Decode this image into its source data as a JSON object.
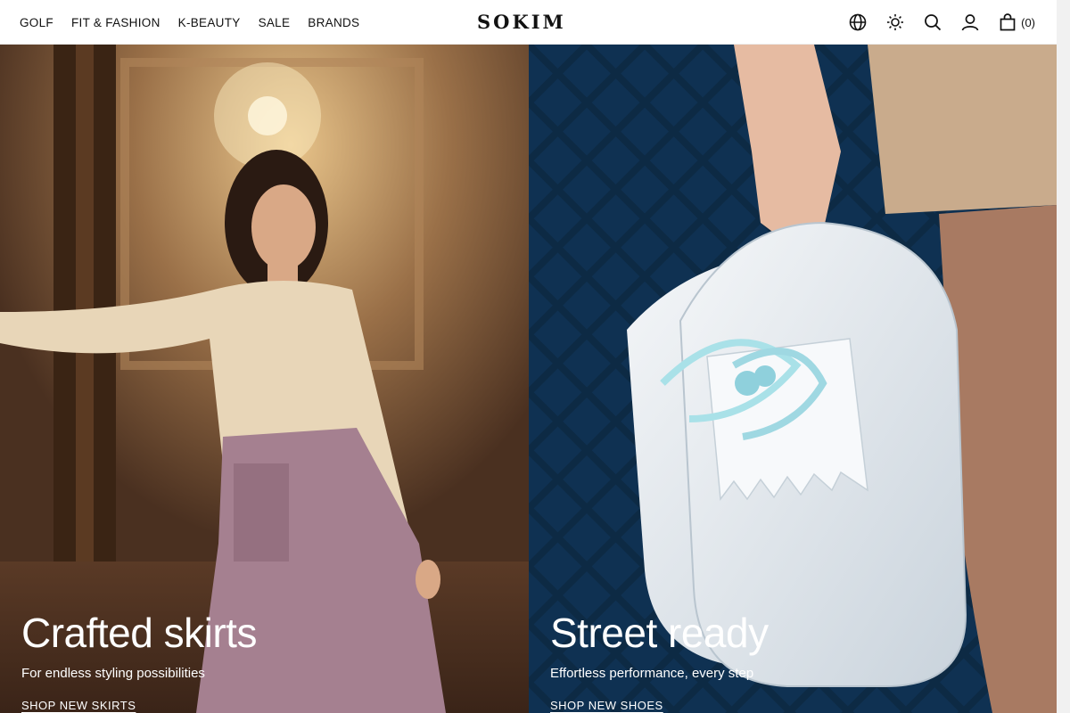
{
  "nav": {
    "links": [
      "GOLF",
      "FIT & FASHION",
      "K-BEAUTY",
      "SALE",
      "BRANDS"
    ]
  },
  "brand": {
    "logo": "SOKIM"
  },
  "header_icons": [
    "globe-icon",
    "sun-icon",
    "search-icon",
    "user-icon",
    "bag-icon"
  ],
  "cart": {
    "count": "(0)"
  },
  "hero": {
    "left": {
      "title": "Crafted skirts",
      "subtitle": "For endless styling possibilities",
      "cta": "SHOP NEW SKIRTS"
    },
    "right": {
      "title": "Street ready",
      "subtitle": "Effortless performance, every step",
      "cta": "SHOP NEW SHOES"
    }
  },
  "colors": {
    "text": "#111111",
    "left_panel_bg": "#6b4a30",
    "right_panel_bg": "#0d2a44",
    "overlay_text": "#ffffff"
  }
}
